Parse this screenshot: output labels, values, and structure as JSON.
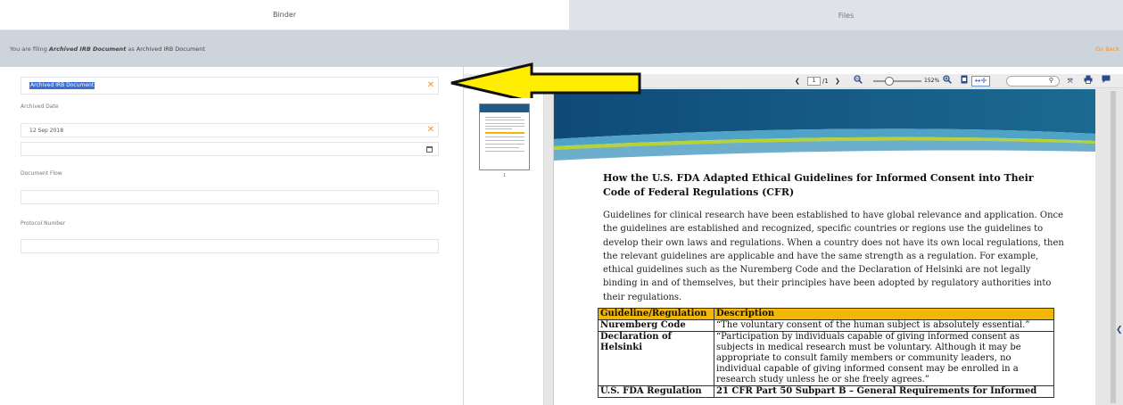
{
  "tabs": {
    "binder": "Binder",
    "files": "Files"
  },
  "filing": {
    "prefix": "You are filing",
    "document": "Archived IRB Document",
    "as_word": "as",
    "target": "Archived IRB Document",
    "go_back": "Go Back"
  },
  "form": {
    "doc_type_value": "Archived IRB Document",
    "archived_date_label": "Archived Date",
    "archived_date_value": "12 Sep 2018",
    "document_flow_label": "Document Flow",
    "protocol_number_label": "Protocol Number"
  },
  "viewer": {
    "page_current": "1",
    "page_total": "/1",
    "zoom": "152%",
    "thumb_page_number": "1",
    "doc_title": "How the U.S. FDA Adapted Ethical Guidelines for Informed Consent into Their Code of Federal Regulations (CFR)",
    "doc_paragraph": "Guidelines for clinical research have been established to have global relevance and application. Once the guidelines are established and recognized, specific countries or regions use the guidelines to develop their own laws and regulations. When a country does not have its own local regulations, then the relevant guidelines are applicable and have the same strength as a regulation. For example, ethical guidelines such as the Nuremberg Code and the Declaration of Helsinki are not legally binding in and of themselves, but their principles have been adopted by regulatory authorities into their regulations.",
    "table": {
      "headers": [
        "Guideline/Regulation",
        "Description"
      ],
      "rows": [
        [
          "Nuremberg Code",
          "“The voluntary consent of the human subject is absolutely essential.”"
        ],
        [
          "Declaration of Helsinki",
          "“Participation by individuals capable of giving informed consent as subjects in medical research must be voluntary. Although it may be appropriate to consult family members or community leaders, no individual capable of giving informed consent may be enrolled in a research study unless he or she freely agrees.”"
        ],
        [
          "U.S. FDA Regulation",
          "21 CFR Part 50 Subpart B – General Requirements for Informed"
        ]
      ]
    }
  },
  "colors": {
    "accent": "#e8953a",
    "table_header": "#f2b705",
    "arrow_fill": "#ffee00",
    "header_blue": "#1e5a8a"
  },
  "icons": [
    "clear-x-icon",
    "calendar-icon",
    "prev-page-icon",
    "next-page-icon",
    "zoom-out-icon",
    "zoom-in-icon",
    "page-fit-icon",
    "fit-width-icon",
    "search-icon",
    "fullscreen-icon",
    "print-icon",
    "comment-icon",
    "collapse-chevron-icon"
  ]
}
